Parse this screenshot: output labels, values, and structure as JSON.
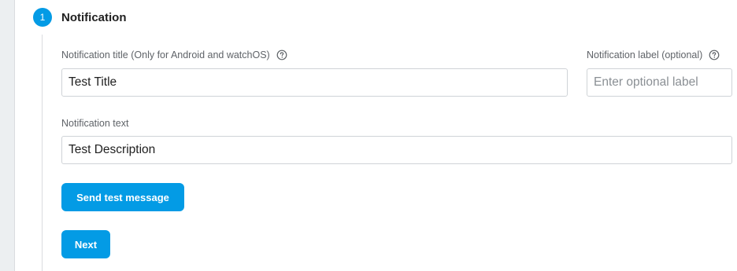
{
  "step": {
    "number": "1",
    "title": "Notification"
  },
  "fields": {
    "title_label": "Notification title (Only for Android and watchOS)",
    "title_value": "Test Title",
    "label_label": "Notification label (optional)",
    "label_placeholder": "Enter optional label",
    "text_label": "Notification text",
    "text_value": "Test Description"
  },
  "buttons": {
    "send_test": "Send test message",
    "next": "Next"
  },
  "icons": {
    "help": "help-circle-icon"
  },
  "colors": {
    "accent": "#039be5",
    "label_text": "#5f6368",
    "input_border": "#cfd3d7"
  }
}
